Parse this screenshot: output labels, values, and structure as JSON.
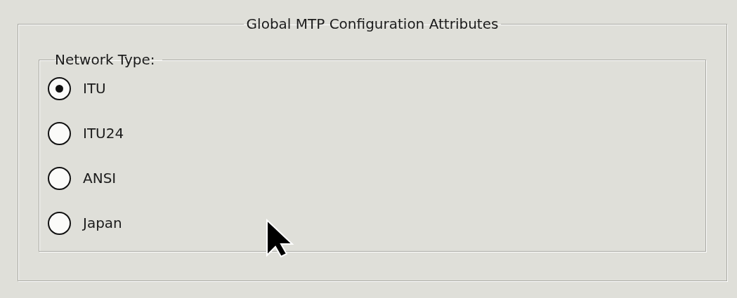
{
  "group": {
    "title": "Global MTP Configuration Attributes"
  },
  "network_type": {
    "label": "Network Type:",
    "options": [
      {
        "label": "ITU",
        "selected": true
      },
      {
        "label": "ITU24",
        "selected": false
      },
      {
        "label": "ANSI",
        "selected": false
      },
      {
        "label": "Japan",
        "selected": false
      }
    ]
  }
}
